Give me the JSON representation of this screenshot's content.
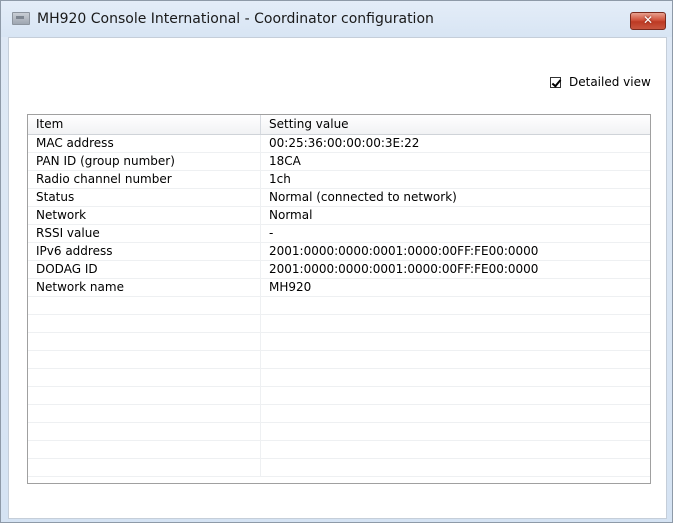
{
  "window": {
    "title": "MH920 Console International - Coordinator configuration",
    "close_label": "✕"
  },
  "options": {
    "detailed_view_label": "Detailed view",
    "detailed_view_checked": true
  },
  "grid": {
    "columns": [
      "Item",
      "Setting value"
    ],
    "rows": [
      {
        "item": "MAC address",
        "value": "00:25:36:00:00:00:3E:22"
      },
      {
        "item": "PAN ID (group number)",
        "value": "18CA"
      },
      {
        "item": "Radio channel number",
        "value": "1ch"
      },
      {
        "item": "Status",
        "value": "Normal (connected to network)"
      },
      {
        "item": "Network",
        "value": "Normal"
      },
      {
        "item": "RSSI value",
        "value": "-"
      },
      {
        "item": "IPv6 address",
        "value": "2001:0000:0000:0001:0000:00FF:FE00:0000"
      },
      {
        "item": "DODAG ID",
        "value": "2001:0000:0000:0001:0000:00FF:FE00:0000"
      },
      {
        "item": "Network name",
        "value": "MH920"
      },
      {
        "item": "",
        "value": ""
      },
      {
        "item": "",
        "value": ""
      },
      {
        "item": "",
        "value": ""
      },
      {
        "item": "",
        "value": ""
      },
      {
        "item": "",
        "value": ""
      },
      {
        "item": "",
        "value": ""
      },
      {
        "item": "",
        "value": ""
      },
      {
        "item": "",
        "value": ""
      },
      {
        "item": "",
        "value": ""
      },
      {
        "item": "",
        "value": ""
      }
    ]
  }
}
